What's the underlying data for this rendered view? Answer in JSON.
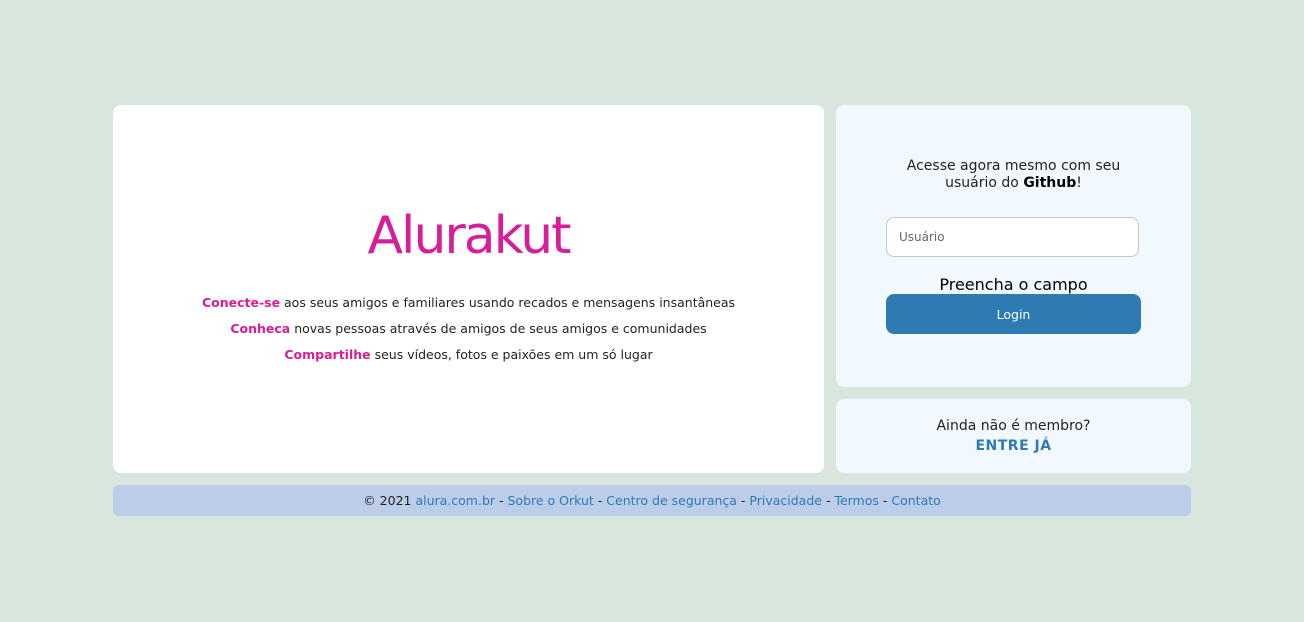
{
  "brand": {
    "logo": "Alurakut",
    "logo_color": "#D81D99"
  },
  "features": [
    {
      "highlight": "Conecte-se",
      "text": " aos seus amigos e familiares usando recados e mensagens insantâneas"
    },
    {
      "highlight": "Conheca",
      "text": " novas pessoas através de amigos de seus amigos e comunidades"
    },
    {
      "highlight": "Compartilhe",
      "text": " seus vídeos, fotos e paixões em um só lugar"
    }
  ],
  "login": {
    "intro_line1": "Acesse agora mesmo com seu",
    "intro_prefix": "usuário do ",
    "intro_bold": "Github",
    "intro_suffix": "!",
    "username_placeholder": "Usuário",
    "username_value": "",
    "field_message": "Preencha o campo",
    "button_label": "Login",
    "button_color": "#2E7BB4"
  },
  "join": {
    "question": "Ainda não é membro?",
    "link_label": "ENTRE JÁ"
  },
  "footer": {
    "copyright": "© 2021 ",
    "links": [
      "alura.com.br",
      "Sobre o Orkut",
      "Centro de segurança",
      "Privacidade",
      "Termos",
      "Contato"
    ],
    "separator": " - "
  },
  "colors": {
    "background": "#D9E6DE",
    "panel": "#FFFFFF",
    "login_panel": "#F1F9FE",
    "footer": "#BBCDE8",
    "link": "#2E7BB4"
  }
}
